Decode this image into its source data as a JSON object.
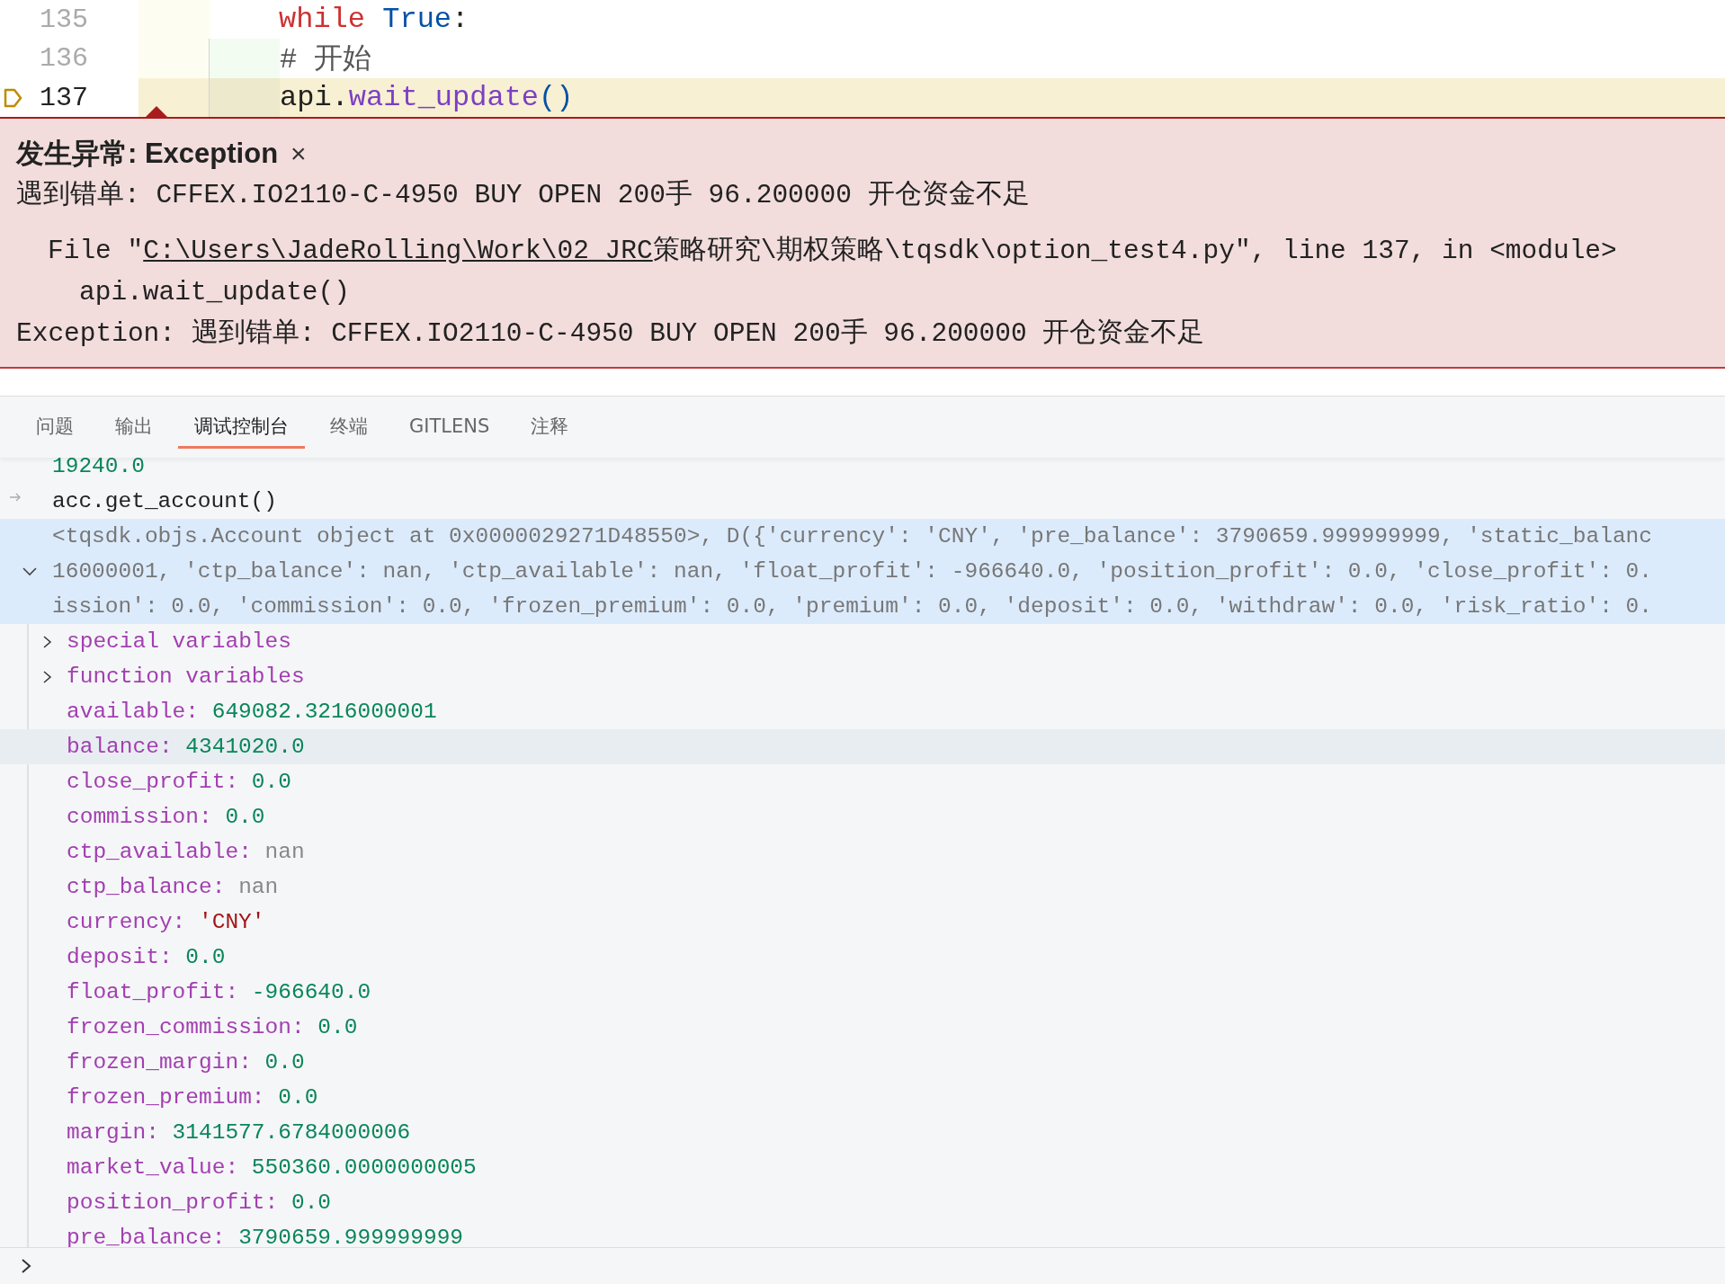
{
  "editor": {
    "lines": [
      {
        "number": "135",
        "current": false,
        "guide": false,
        "tokens": [
          {
            "kind": "keyword",
            "text": "while"
          },
          {
            "kind": "constant",
            "text": " True"
          },
          {
            "kind": "plain",
            "text": ":"
          }
        ]
      },
      {
        "number": "136",
        "current": false,
        "guide": true,
        "tokens": [
          {
            "kind": "comment",
            "text": "# 开始"
          }
        ]
      },
      {
        "number": "137",
        "current": true,
        "guide": true,
        "tokens": [
          {
            "kind": "plain",
            "text": "api."
          },
          {
            "kind": "function",
            "text": "wait_update"
          },
          {
            "kind": "paren",
            "text": "()"
          }
        ]
      }
    ]
  },
  "exception": {
    "title": "发生异常: Exception",
    "close": "×",
    "message": "遇到错单: CFFEX.IO2110-C-4950 BUY OPEN 200手 96.200000 开仓资金不足",
    "trace_prefix": "File \"",
    "trace_link": "C:\\Users\\JadeRolling\\Work\\02_JRC",
    "trace_suffix": "策略研究\\期权策略\\tqsdk\\option_test4.py\", line 137, in <module>",
    "trace_code": "api.wait_update()",
    "final": "Exception: 遇到错单: CFFEX.IO2110-C-4950 BUY OPEN 200手 96.200000 开仓资金不足"
  },
  "tabs": [
    {
      "label": "问题",
      "selected": false
    },
    {
      "label": "输出",
      "selected": false
    },
    {
      "label": "调试控制台",
      "selected": true
    },
    {
      "label": "终端",
      "selected": false
    },
    {
      "label": "GITLENS",
      "selected": false
    },
    {
      "label": "注释",
      "selected": false
    }
  ],
  "console": {
    "previous_value": "19240.0",
    "input": "acc.get_account()",
    "result": {
      "expanded": true,
      "lines": [
        "<tqsdk.objs.Account object at 0x0000029271D48550>, D({'currency': 'CNY', 'pre_balance': 3790659.999999999, 'static_balanc",
        "16000001, 'ctp_balance': nan, 'ctp_available': nan, 'float_profit': -966640.0, 'position_profit': 0.0, 'close_profit': 0.",
        "ission': 0.0, 'commission': 0.0, 'frozen_premium': 0.0, 'premium': 0.0, 'deposit': 0.0, 'withdraw': 0.0, 'risk_ratio': 0."
      ]
    },
    "groups": [
      {
        "label": "special variables",
        "expanded": false
      },
      {
        "label": "function variables",
        "expanded": false
      }
    ],
    "variables": [
      {
        "name": "available:",
        "value": "649082.3216000001",
        "kind": "number",
        "selected": false
      },
      {
        "name": "balance:",
        "value": "4341020.0",
        "kind": "number",
        "selected": true
      },
      {
        "name": "close_profit:",
        "value": "0.0",
        "kind": "number",
        "selected": false
      },
      {
        "name": "commission:",
        "value": "0.0",
        "kind": "number",
        "selected": false
      },
      {
        "name": "ctp_available:",
        "value": "nan",
        "kind": "none",
        "selected": false
      },
      {
        "name": "ctp_balance:",
        "value": "nan",
        "kind": "none",
        "selected": false
      },
      {
        "name": "currency:",
        "value": "'CNY'",
        "kind": "string",
        "selected": false
      },
      {
        "name": "deposit:",
        "value": "0.0",
        "kind": "number",
        "selected": false
      },
      {
        "name": "float_profit:",
        "value": "-966640.0",
        "kind": "number",
        "selected": false
      },
      {
        "name": "frozen_commission:",
        "value": "0.0",
        "kind": "number",
        "selected": false
      },
      {
        "name": "frozen_margin:",
        "value": "0.0",
        "kind": "number",
        "selected": false
      },
      {
        "name": "frozen_premium:",
        "value": "0.0",
        "kind": "number",
        "selected": false
      },
      {
        "name": "margin:",
        "value": "3141577.6784000006",
        "kind": "number",
        "selected": false
      },
      {
        "name": "market_value:",
        "value": "550360.0000000005",
        "kind": "number",
        "selected": false
      },
      {
        "name": "position_profit:",
        "value": "0.0",
        "kind": "number",
        "selected": false
      },
      {
        "name": "pre_balance:",
        "value": "3790659.999999999",
        "kind": "number",
        "selected": false
      }
    ]
  }
}
